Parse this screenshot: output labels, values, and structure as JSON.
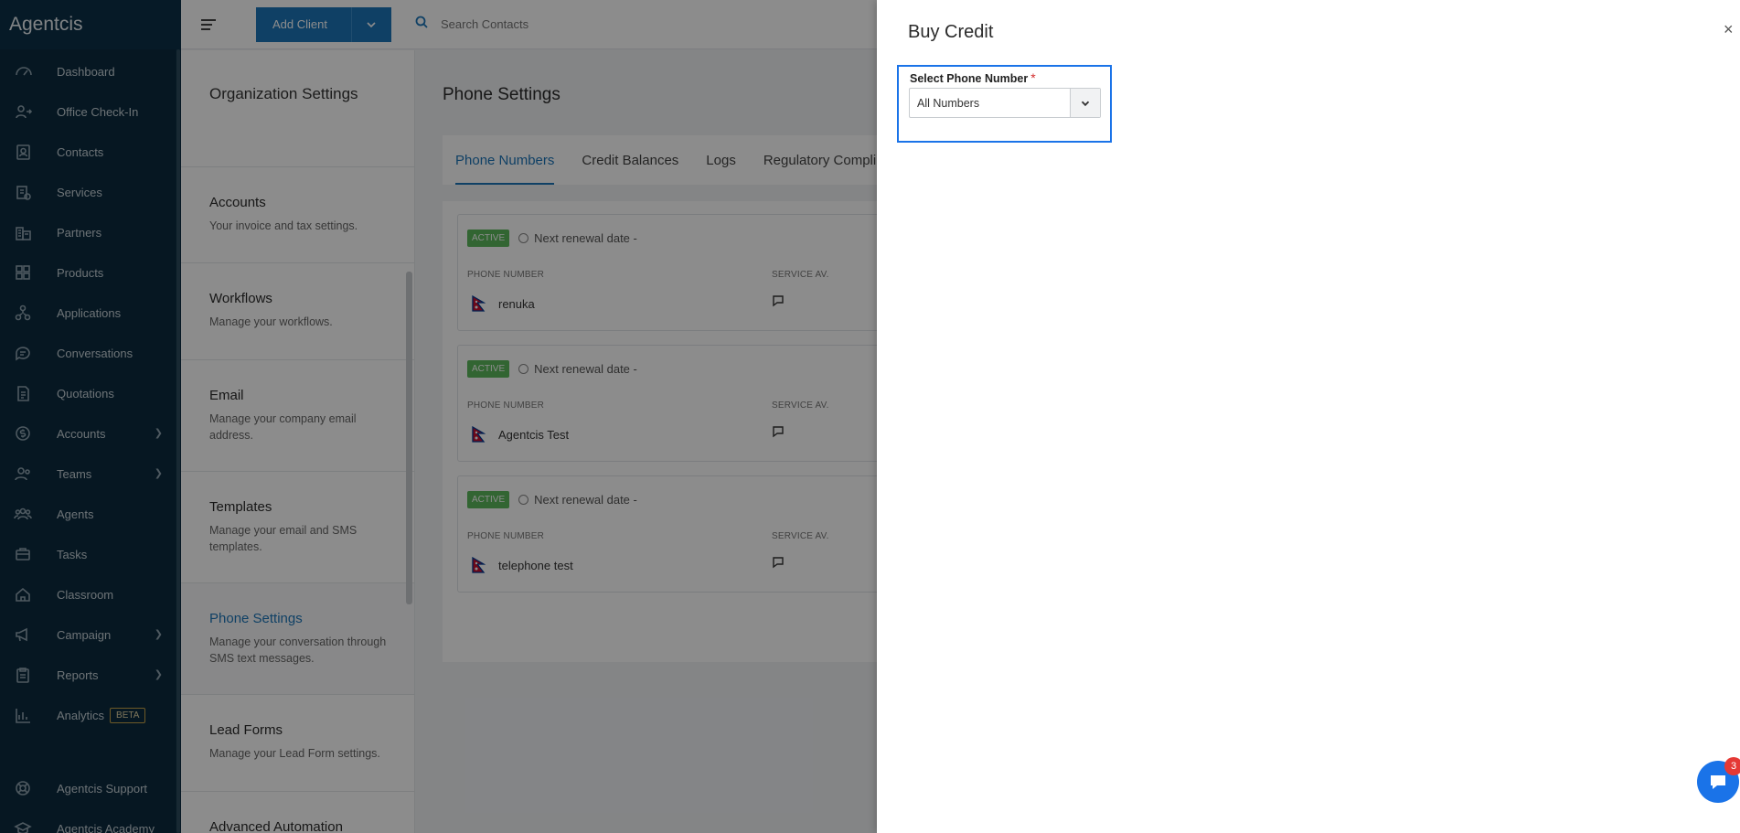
{
  "app": {
    "brand": "Agentcis"
  },
  "sidebar": {
    "items": [
      {
        "label": "Dashboard",
        "icon": "dashboard-icon",
        "has_submenu": false
      },
      {
        "label": "Office Check-In",
        "icon": "office-checkin-icon",
        "has_submenu": false
      },
      {
        "label": "Contacts",
        "icon": "contacts-icon",
        "has_submenu": false
      },
      {
        "label": "Services",
        "icon": "services-icon",
        "has_submenu": false
      },
      {
        "label": "Partners",
        "icon": "partners-icon",
        "has_submenu": false
      },
      {
        "label": "Products",
        "icon": "products-icon",
        "has_submenu": false
      },
      {
        "label": "Applications",
        "icon": "applications-icon",
        "has_submenu": false
      },
      {
        "label": "Conversations",
        "icon": "conversations-icon",
        "has_submenu": false
      },
      {
        "label": "Quotations",
        "icon": "quotations-icon",
        "has_submenu": false
      },
      {
        "label": "Accounts",
        "icon": "accounts-icon",
        "has_submenu": true
      },
      {
        "label": "Teams",
        "icon": "teams-icon",
        "has_submenu": true
      },
      {
        "label": "Agents",
        "icon": "agents-icon",
        "has_submenu": false
      },
      {
        "label": "Tasks",
        "icon": "tasks-icon",
        "has_submenu": false
      },
      {
        "label": "Classroom",
        "icon": "classroom-icon",
        "has_submenu": false
      },
      {
        "label": "Campaign",
        "icon": "campaign-icon",
        "has_submenu": true
      },
      {
        "label": "Reports",
        "icon": "reports-icon",
        "has_submenu": true
      },
      {
        "label": "Analytics",
        "icon": "analytics-icon",
        "has_submenu": false,
        "badge": "BETA"
      }
    ],
    "bottom": [
      {
        "label": "Agentcis Support",
        "icon": "support-icon"
      },
      {
        "label": "Agentcis Academy",
        "icon": "academy-icon"
      }
    ]
  },
  "topbar": {
    "add_client_label": "Add Client",
    "search_placeholder": "Search Contacts"
  },
  "org_settings": {
    "title": "Organization Settings",
    "items": [
      {
        "title": "Accounts",
        "desc": "Your invoice and tax settings."
      },
      {
        "title": "Workflows",
        "desc": "Manage your workflows."
      },
      {
        "title": "Email",
        "desc": "Manage your company email address."
      },
      {
        "title": "Templates",
        "desc": "Manage your email and SMS templates."
      },
      {
        "title": "Phone Settings",
        "desc": "Manage your conversation through SMS text messages.",
        "active": true
      },
      {
        "title": "Lead Forms",
        "desc": "Manage your Lead Form settings."
      },
      {
        "title": "Advanced Automation",
        "desc": ""
      }
    ]
  },
  "phone_settings": {
    "title": "Phone Settings",
    "tabs": [
      "Phone Numbers",
      "Credit Balances",
      "Logs",
      "Regulatory Compli"
    ],
    "active_tab": "Phone Numbers",
    "col_phone": "PHONE NUMBER",
    "col_service": "SERVICE AV.",
    "numbers": [
      {
        "status": "ACTIVE",
        "renewal": "Next renewal date -",
        "name": "renuka"
      },
      {
        "status": "ACTIVE",
        "renewal": "Next renewal date -",
        "name": "Agentcis Test"
      },
      {
        "status": "ACTIVE",
        "renewal": "Next renewal date -",
        "name": "telephone test"
      }
    ]
  },
  "drawer": {
    "title": "Buy Credit",
    "close": "×",
    "field_label": "Select Phone Number",
    "required_mark": "*",
    "selected_value": "All Numbers"
  },
  "chat_widget": {
    "count": "3"
  },
  "colors": {
    "accent": "#1d76b9",
    "sidebar_bg": "#0b2b3f",
    "focus": "#1a73e8",
    "active_badge": "#5cb85c"
  }
}
